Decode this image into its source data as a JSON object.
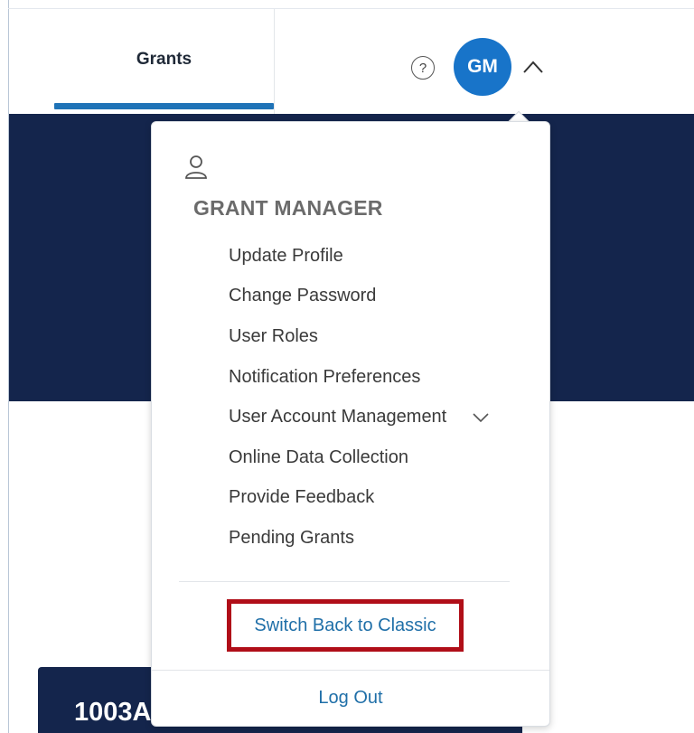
{
  "header": {
    "tab_label": "Grants",
    "help_glyph": "?",
    "avatar_initials": "GM",
    "accent_color": "#1f73b7",
    "avatar_color": "#1874c9",
    "banner_color": "#14254c"
  },
  "dropdown": {
    "role_title": "GRANT MANAGER",
    "items": [
      {
        "label": "Update Profile"
      },
      {
        "label": "Change Password"
      },
      {
        "label": "User Roles"
      },
      {
        "label": "Notification Preferences"
      },
      {
        "label": "User Account Management",
        "expandable": true
      },
      {
        "label": "Online Data Collection"
      },
      {
        "label": "Provide Feedback"
      },
      {
        "label": "Pending Grants"
      }
    ],
    "switch_label": "Switch Back to Classic",
    "switch_highlight_color": "#b00e18",
    "logout_label": "Log Out",
    "link_color": "#1f6fa8"
  },
  "card": {
    "title_partial": "1003A"
  },
  "icons": [
    "help-icon",
    "chevron-up-icon",
    "user-icon",
    "chevron-down-icon"
  ]
}
